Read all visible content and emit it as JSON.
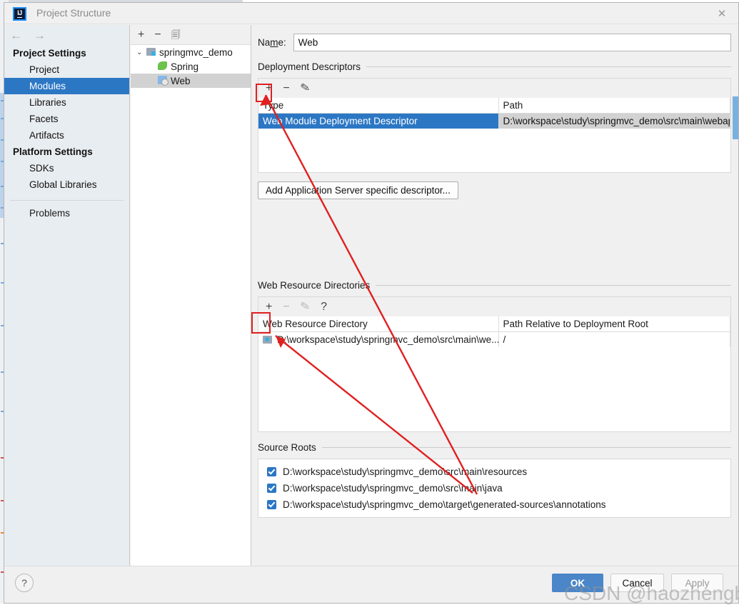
{
  "window": {
    "title": "Project Structure",
    "logo_text": "IJ",
    "close_icon": "close-icon"
  },
  "sidebar": {
    "nav_back": "←",
    "nav_forward": "→",
    "sections": [
      {
        "heading": "Project Settings",
        "items": [
          {
            "label": "Project",
            "selected": false
          },
          {
            "label": "Modules",
            "selected": true
          },
          {
            "label": "Libraries",
            "selected": false
          },
          {
            "label": "Facets",
            "selected": false
          },
          {
            "label": "Artifacts",
            "selected": false
          }
        ]
      },
      {
        "heading": "Platform Settings",
        "items": [
          {
            "label": "SDKs",
            "selected": false
          },
          {
            "label": "Global Libraries",
            "selected": false
          }
        ]
      }
    ],
    "problems_label": "Problems"
  },
  "tree": {
    "toolbar": {
      "add": "+",
      "remove": "−",
      "copy": "copy-icon"
    },
    "nodes": [
      {
        "label": "springmvc_demo",
        "icon": "folder-module-icon",
        "level": 0,
        "expanded": true,
        "selected": false
      },
      {
        "label": "Spring",
        "icon": "spring-leaf-icon",
        "level": 1,
        "selected": false
      },
      {
        "label": "Web",
        "icon": "web-facet-icon",
        "level": 1,
        "selected": true
      }
    ]
  },
  "main": {
    "name_label": "Name:",
    "name_value": "Web",
    "deployment_descriptors": {
      "title": "Deployment Descriptors",
      "toolbar": {
        "add": "+",
        "remove": "−",
        "edit": "pencil-icon"
      },
      "columns": [
        "Type",
        "Path"
      ],
      "rows": [
        {
          "type": "Web Module Deployment Descriptor",
          "path": "D:\\workspace\\study\\springmvc_demo\\src\\main\\webapp\\",
          "selected": true
        }
      ],
      "add_server_descriptor_button": "Add Application Server specific descriptor..."
    },
    "web_resource_directories": {
      "title": "Web Resource Directories",
      "toolbar": {
        "add": "+",
        "remove": "−",
        "edit": "pencil-icon",
        "help": "?"
      },
      "columns": [
        "Web Resource Directory",
        "Path Relative to Deployment Root"
      ],
      "rows": [
        {
          "directory": "D:\\workspace\\study\\springmvc_demo\\src\\main\\we...",
          "relative_path": "/"
        }
      ]
    },
    "source_roots": {
      "title": "Source Roots",
      "rows": [
        {
          "path": "D:\\workspace\\study\\springmvc_demo\\src\\main\\resources",
          "checked": true
        },
        {
          "path": "D:\\workspace\\study\\springmvc_demo\\src\\main\\java",
          "checked": true
        },
        {
          "path": "D:\\workspace\\study\\springmvc_demo\\target\\generated-sources\\annotations",
          "checked": true
        }
      ]
    }
  },
  "footer": {
    "help": "?",
    "ok": "OK",
    "cancel": "Cancel",
    "apply": "Apply"
  },
  "watermark": "CSDN @haozhengblack",
  "colors": {
    "selection_blue": "#2c77c4",
    "annotation_red": "#e02020",
    "ok_button": "#4a86c8",
    "dialog_bg": "#f0f0f0",
    "sidebar_bg": "#e8edf1"
  }
}
